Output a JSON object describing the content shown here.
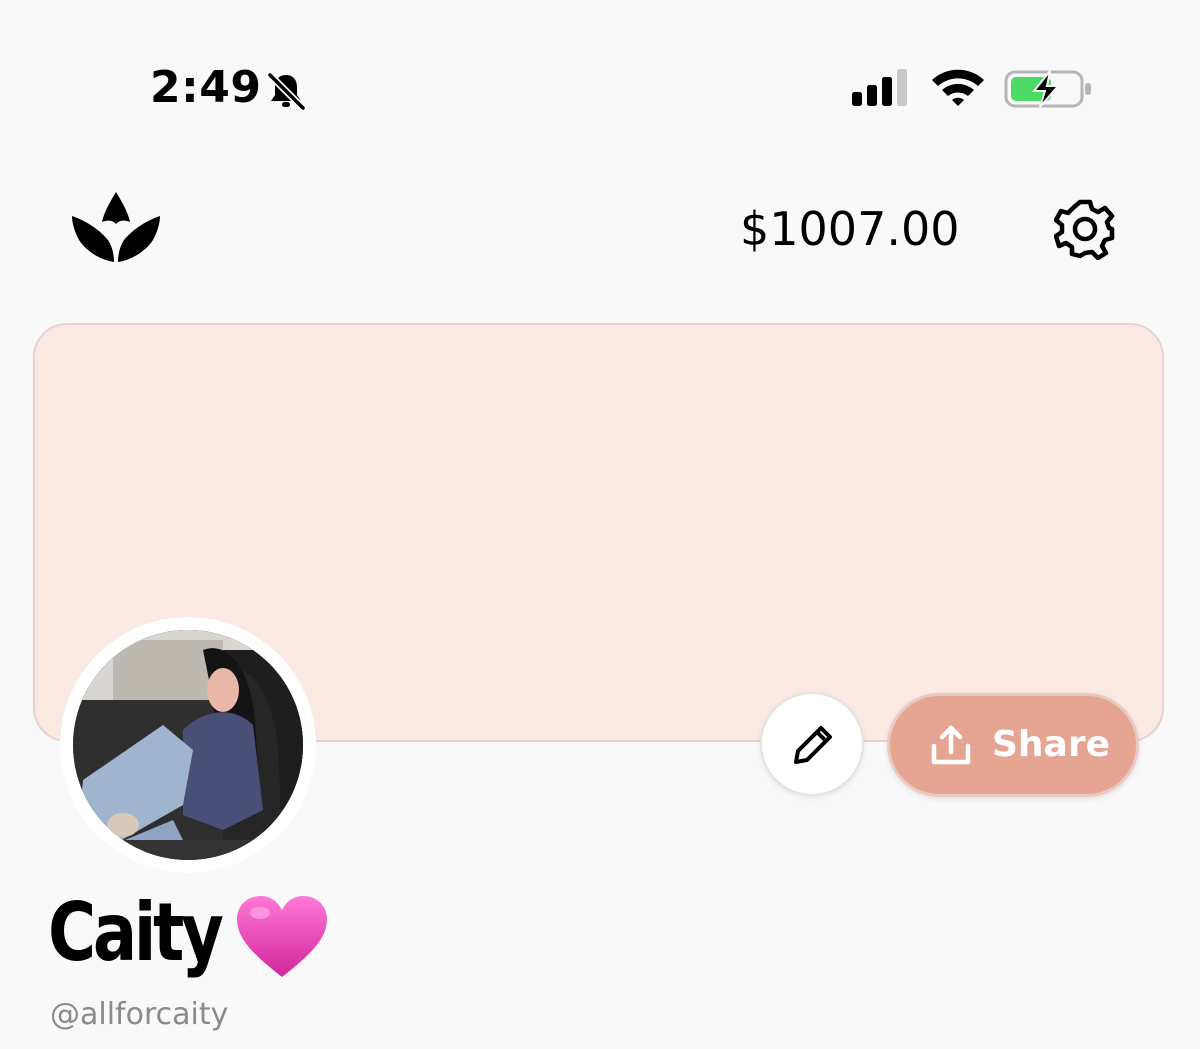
{
  "status_bar": {
    "time": "2:49",
    "icons": [
      "bell-slash-icon",
      "cellular-signal-icon",
      "wifi-icon",
      "battery-charging-icon"
    ]
  },
  "header": {
    "logo": "crown-logo-icon",
    "balance": "$1007.00",
    "settings_icon": "gear-icon"
  },
  "profile": {
    "name": "Caity",
    "name_emoji": "pink-heart-icon",
    "handle": "@allforcaity",
    "avatar": "profile-photo"
  },
  "actions": {
    "edit_icon": "pencil-icon",
    "share_label": "Share",
    "share_icon": "upload-icon"
  },
  "colors": {
    "background": "#f9f9f9",
    "banner": "#fbe9e3",
    "share_button": "#e5a592",
    "heart": "#e23fae",
    "battery_fill": "#4cd964"
  }
}
